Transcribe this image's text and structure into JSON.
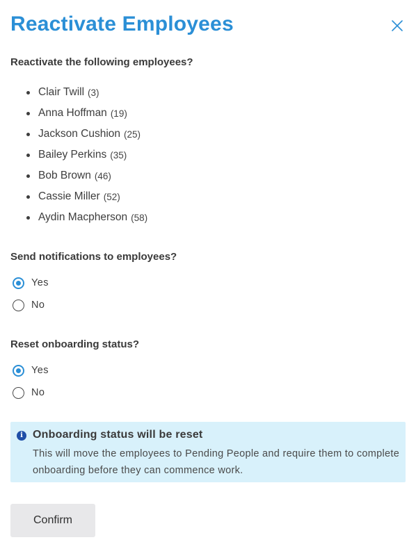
{
  "dialog": {
    "title": "Reactivate Employees",
    "close_icon": "close-icon"
  },
  "employees_section": {
    "label": "Reactivate the following employees?",
    "employees": [
      {
        "name": "Clair Twill",
        "id": "(3)"
      },
      {
        "name": "Anna Hoffman",
        "id": "(19)"
      },
      {
        "name": "Jackson Cushion",
        "id": "(25)"
      },
      {
        "name": "Bailey Perkins",
        "id": "(35)"
      },
      {
        "name": "Bob Brown",
        "id": "(46)"
      },
      {
        "name": "Cassie Miller",
        "id": "(52)"
      },
      {
        "name": "Aydin Macpherson",
        "id": "(58)"
      }
    ]
  },
  "notifications": {
    "label": "Send notifications to employees?",
    "options": [
      {
        "label": "Yes",
        "selected": true
      },
      {
        "label": "No",
        "selected": false
      }
    ]
  },
  "onboarding": {
    "label": "Reset onboarding status?",
    "options": [
      {
        "label": "Yes",
        "selected": true
      },
      {
        "label": "No",
        "selected": false
      }
    ]
  },
  "alert": {
    "icon": "info-icon",
    "title": "Onboarding status will be reset",
    "body": "This will move the employees to Pending People and require them to complete onboarding before they can commence work."
  },
  "actions": {
    "confirm_label": "Confirm"
  },
  "colors": {
    "accent": "#2b8fd6",
    "alert_bg": "#d8f1fb",
    "info_icon": "#1f4fa8",
    "button_bg": "#e8e8ea"
  }
}
